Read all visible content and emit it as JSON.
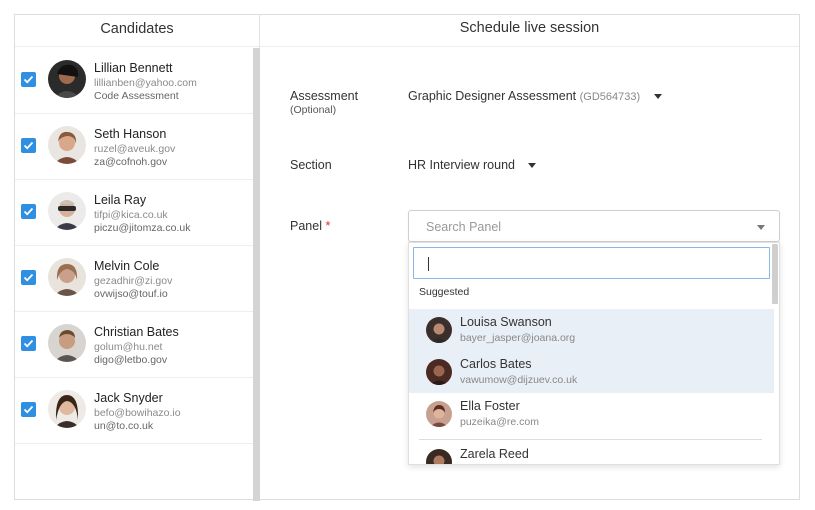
{
  "left_title": "Candidates",
  "right_title": "Schedule live session",
  "candidates": [
    {
      "name": "Lillian Bennett",
      "line1": "lillianben@yahoo.com",
      "line2": "Code Assessment",
      "checked": true
    },
    {
      "name": "Seth Hanson",
      "line1": "ruzel@aveuk.gov",
      "line2": "za@cofnoh.gov",
      "checked": true
    },
    {
      "name": "Leila Ray",
      "line1": "tifpi@kica.co.uk",
      "line2": "piczu@jitomza.co.uk",
      "checked": true
    },
    {
      "name": "Melvin Cole",
      "line1": "gezadhir@zi.gov",
      "line2": "ovwijso@touf.io",
      "checked": true
    },
    {
      "name": "Christian Bates",
      "line1": "golum@hu.net",
      "line2": "digo@letbo.gov",
      "checked": true
    },
    {
      "name": "Jack Snyder",
      "line1": "befo@bowihazo.io",
      "line2": "un@to.co.uk",
      "checked": true
    }
  ],
  "form": {
    "assessment_label": "Assessment",
    "assessment_optional": "(Optional)",
    "assessment_value": "Graphic Designer Assessment",
    "assessment_code": "(GD564733)",
    "section_label": "Section",
    "section_value": "HR Interview round",
    "panel_label": "Panel",
    "panel_required": "*",
    "panel_placeholder": "Search Panel"
  },
  "dropdown": {
    "search_value": "",
    "suggested_label": "Suggested",
    "items": [
      {
        "name": "Louisa Swanson",
        "email": "bayer_jasper@joana.org",
        "highlighted": true
      },
      {
        "name": "Carlos Bates",
        "email": "vawumow@dijzuev.co.uk",
        "highlighted": true
      },
      {
        "name": "Ella Foster",
        "email": "puzeika@re.com",
        "highlighted": false
      },
      {
        "name": "Zarela Reed",
        "email": "",
        "highlighted": false
      }
    ]
  },
  "colors": {
    "checkbox": "#2f8fe0",
    "highlight": "#e9eff6",
    "required": "#d93025",
    "input_focus": "#8ab8e6"
  }
}
